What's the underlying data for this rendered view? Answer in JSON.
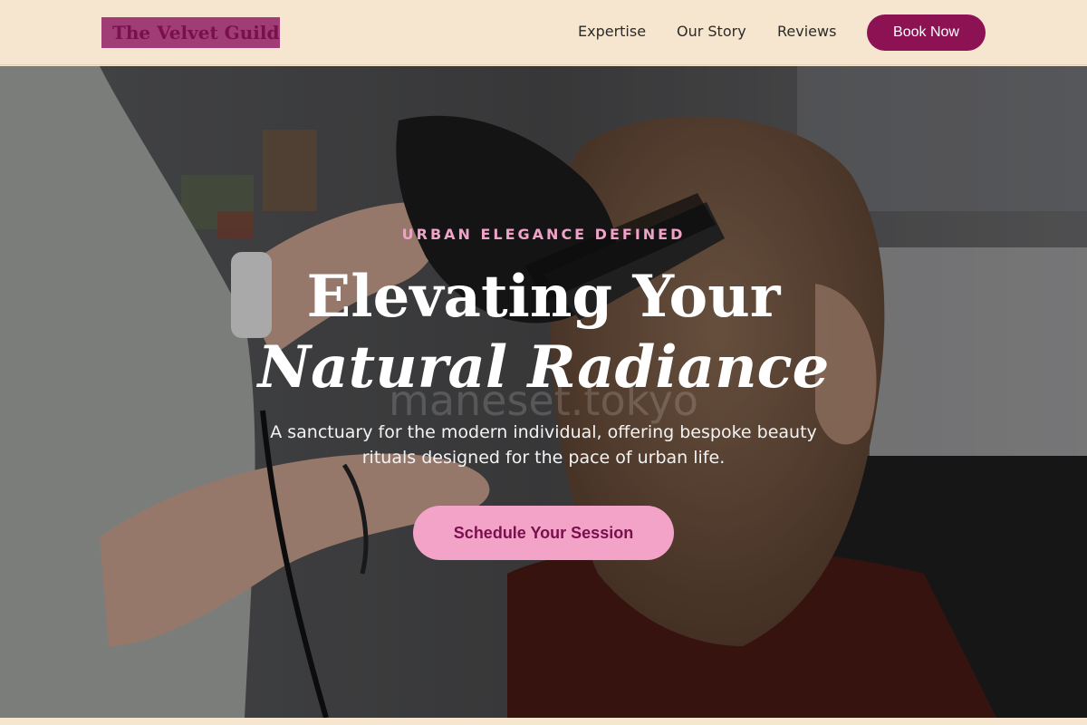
{
  "brand": {
    "name": "The Velvet Guild"
  },
  "nav": {
    "items": [
      {
        "label": "Expertise"
      },
      {
        "label": "Our Story"
      },
      {
        "label": "Reviews"
      }
    ],
    "cta_label": "Book Now"
  },
  "hero": {
    "eyebrow": "URBAN ELEGANCE DEFINED",
    "headline_line1": "Elevating Your",
    "headline_line2": "Natural Radiance",
    "watermark": "maneset.tokyo",
    "subtext": "A sanctuary for the modern individual, offering bespoke beauty rituals designed for the pace of urban life.",
    "cta_label": "Schedule Your Session"
  },
  "colors": {
    "brand_plum": "#8c1254",
    "logo_bg": "#a03d76",
    "cream": "#f7e6cf",
    "accent_pink": "#f3a3c8",
    "eyebrow_pink": "#f0a2c8"
  }
}
